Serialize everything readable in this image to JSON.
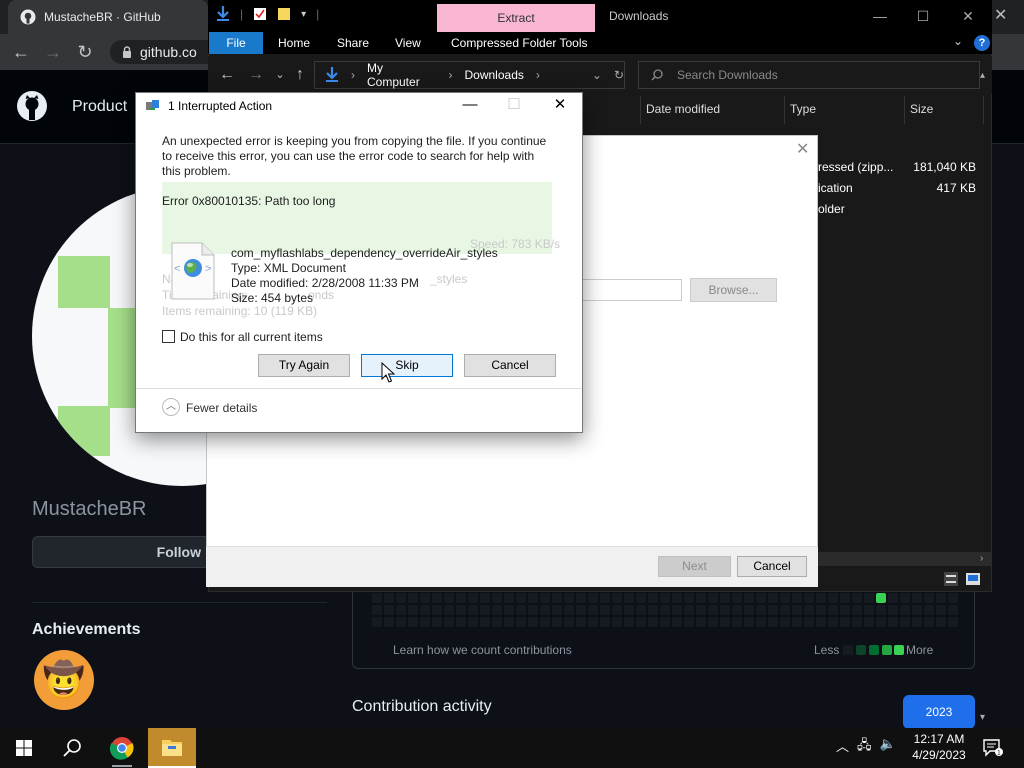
{
  "browser": {
    "tab_title": "MustacheBR · GitHub",
    "url": "github.co"
  },
  "github": {
    "nav_product": "Product",
    "username": "MustacheBR",
    "follow_label": "Follow",
    "achievements_title": "Achievements",
    "contrib_learn": "Learn how we count contributions",
    "legend_less": "Less",
    "legend_more": "More",
    "contribution_activity": "Contribution activity",
    "year_button": "2023",
    "colors": {
      "bg": "#0d1117",
      "accent": "#1f6feb",
      "green": "#39d353"
    }
  },
  "explorer": {
    "extract_tab": "Extract",
    "window_title": "Downloads",
    "ribbon_tabs": [
      "File",
      "Home",
      "Share",
      "View",
      "Compressed Folder Tools"
    ],
    "breadcrumb": [
      "My Computer",
      "Downloads"
    ],
    "search_placeholder": "Search Downloads",
    "columns": [
      "Date modified",
      "Type",
      "Size"
    ],
    "rows": [
      {
        "type": "ressed (zipp...",
        "size": "181,040 KB"
      },
      {
        "type": "ication",
        "size": "417 KB"
      },
      {
        "type": "older",
        "size": ""
      }
    ]
  },
  "wizard": {
    "browse_label": "Browse...",
    "next_label": "Next",
    "cancel_label": "Cancel"
  },
  "dialog": {
    "title": "1 Interrupted Action",
    "message": "An unexpected error is keeping you from copying the file. If you continue to receive this error, you can use the error code to search for help with this problem.",
    "error": "Error 0x80010135: Path too long",
    "file_name": "com_myflashlabs_dependency_overrideAir_styles",
    "file_type": "Type: XML Document",
    "file_date": "Date modified: 2/28/2008 11:33 PM",
    "file_size": "Size: 454 bytes",
    "ghost_speed": "Speed: 783 KB/s",
    "ghost_name": "Name:",
    "ghost_name_value": "_styles",
    "ghost_time": "Time remaining:",
    "ghost_time_value": "onds",
    "ghost_items": "Items remaining: 10 (119 KB)",
    "checkbox_label": "Do this for all current items",
    "try_again": "Try Again",
    "skip": "Skip",
    "cancel": "Cancel",
    "fewer_details": "Fewer details"
  },
  "taskbar": {
    "time": "12:17 AM",
    "date": "4/29/2023"
  }
}
